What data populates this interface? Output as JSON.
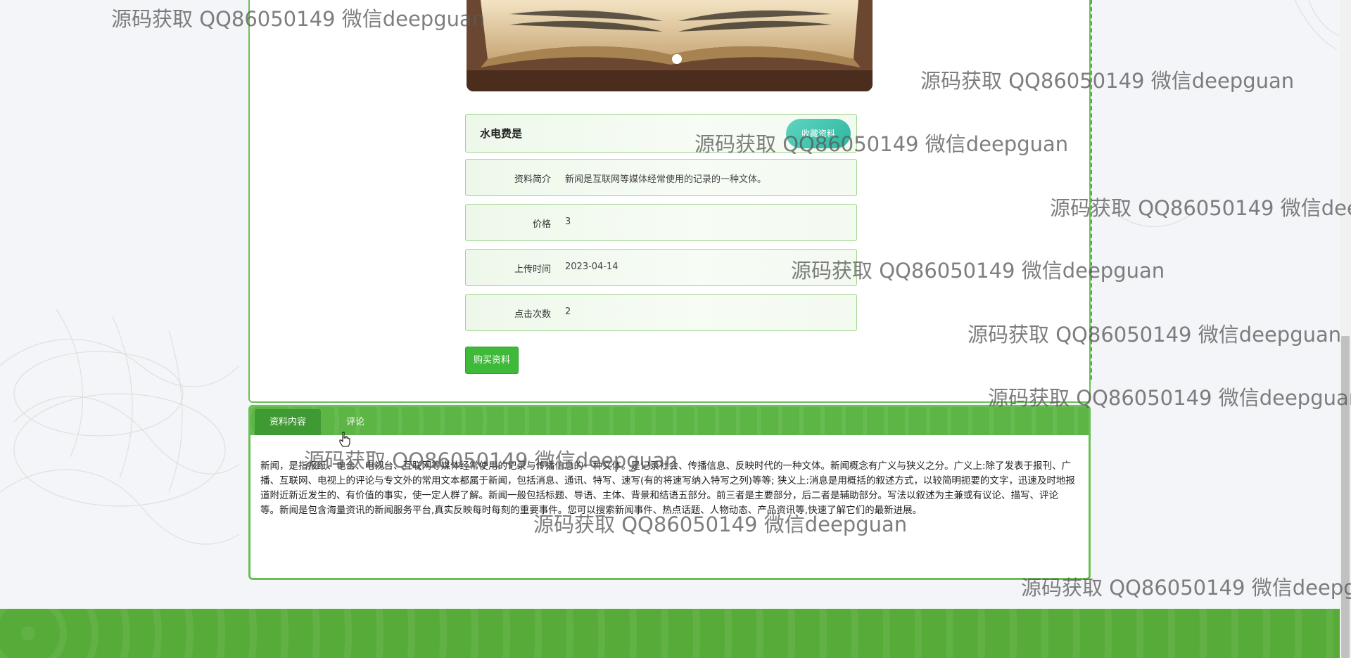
{
  "product": {
    "title": "水电费是",
    "collect_label": "收藏资料",
    "fields": [
      {
        "label": "资料简介",
        "value": "新闻是互联网等媒体经常使用的记录的一种文体。"
      },
      {
        "label": "价格",
        "value": "3"
      },
      {
        "label": "上传时间",
        "value": "2023-04-14"
      },
      {
        "label": "点击次数",
        "value": "2"
      }
    ],
    "buy_label": "购买资料"
  },
  "tabs": {
    "items": [
      {
        "label": "资料内容"
      },
      {
        "label": "评论"
      }
    ],
    "active_index": 0,
    "content": "新闻，是指报纸、电台、电视台、互联网等媒体经常使用的记录与传播信息的一种文体。是记录社会、传播信息、反映时代的一种文体。新闻概念有广义与狭义之分。广义上:除了发表于报刊、广播、互联网、电视上的评论与专文外的常用文本都属于新闻，包括消息、通讯、特写、速写(有的将速写纳入特写之列)等等; 狭义上:消息是用概括的叙述方式，以较简明扼要的文字，迅速及时地报道附近新近发生的、有价值的事实，使一定人群了解。新闻一般包括标题、导语、主体、背景和结语五部分。前三者是主要部分，后二者是辅助部分。写法以叙述为主兼或有议论、描写、评论等。新闻是包含海量资讯的新闻服务平台,真实反映每时每刻的重要事件。您可以搜索新闻事件、热点话题、人物动态、产品资讯等,快速了解它们的最新进展。"
  },
  "carousel": {
    "active_dot": 1,
    "dots": 1
  },
  "watermark": {
    "text": "源码获取 QQ86050149 微信deepguan"
  },
  "colors": {
    "accent_green": "#6bbf56",
    "buy_button": "#3fb93a",
    "collect_button": "#3bc4ad",
    "footer": "#57ac39"
  }
}
